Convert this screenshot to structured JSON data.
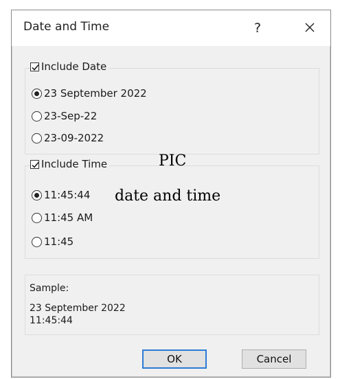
{
  "dialog": {
    "title": "Date and Time",
    "help_label": "?",
    "close_icon": "close-icon"
  },
  "date_group": {
    "checkbox_label": "Include Date",
    "checked": true,
    "options": [
      "23 September 2022",
      "23-Sep-22",
      "23-09-2022"
    ],
    "selected_index": 0
  },
  "time_group": {
    "checkbox_label": "Include Time",
    "checked": true,
    "options": [
      "11:45:44",
      "11:45 AM",
      "11:45"
    ],
    "selected_index": 0
  },
  "overlay": {
    "label_pic": "PIC",
    "label_date_time": "date and time"
  },
  "sample": {
    "label": "Sample:",
    "line1": "23 September 2022",
    "line2": "11:45:44"
  },
  "buttons": {
    "ok": "OK",
    "cancel": "Cancel"
  },
  "colors": {
    "dialog_bg": "#f0f0f0",
    "default_button_border": "#2b7bd6"
  }
}
